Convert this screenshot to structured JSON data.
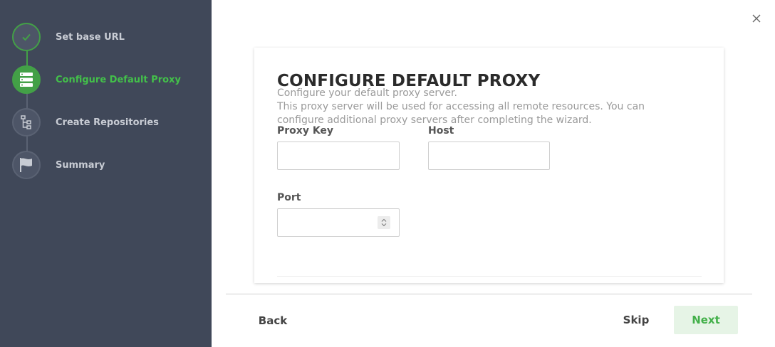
{
  "sidebar": {
    "steps": [
      {
        "label": "Set base URL",
        "state": "done",
        "icon": "check-icon"
      },
      {
        "label": "Configure Default Proxy",
        "state": "active",
        "icon": "server-stack-icon"
      },
      {
        "label": "Create Repositories",
        "state": "pending",
        "icon": "tree-list-icon"
      },
      {
        "label": "Summary",
        "state": "pending",
        "icon": "flag-icon"
      }
    ]
  },
  "card": {
    "title": "CONFIGURE DEFAULT PROXY",
    "description": "Configure your default proxy server.\nThis proxy server will be used for accessing all remote resources. You can configure additional proxy servers after completing the wizard.",
    "fields": {
      "proxy_key": {
        "label": "Proxy Key",
        "value": ""
      },
      "host": {
        "label": "Host",
        "value": ""
      },
      "port": {
        "label": "Port",
        "value": ""
      }
    }
  },
  "footer": {
    "back_label": "Back",
    "skip_label": "Skip",
    "next_label": "Next"
  },
  "colors": {
    "sidebar_bg": "#404859",
    "accent_green": "#43a047",
    "active_text": "#43c04a"
  }
}
